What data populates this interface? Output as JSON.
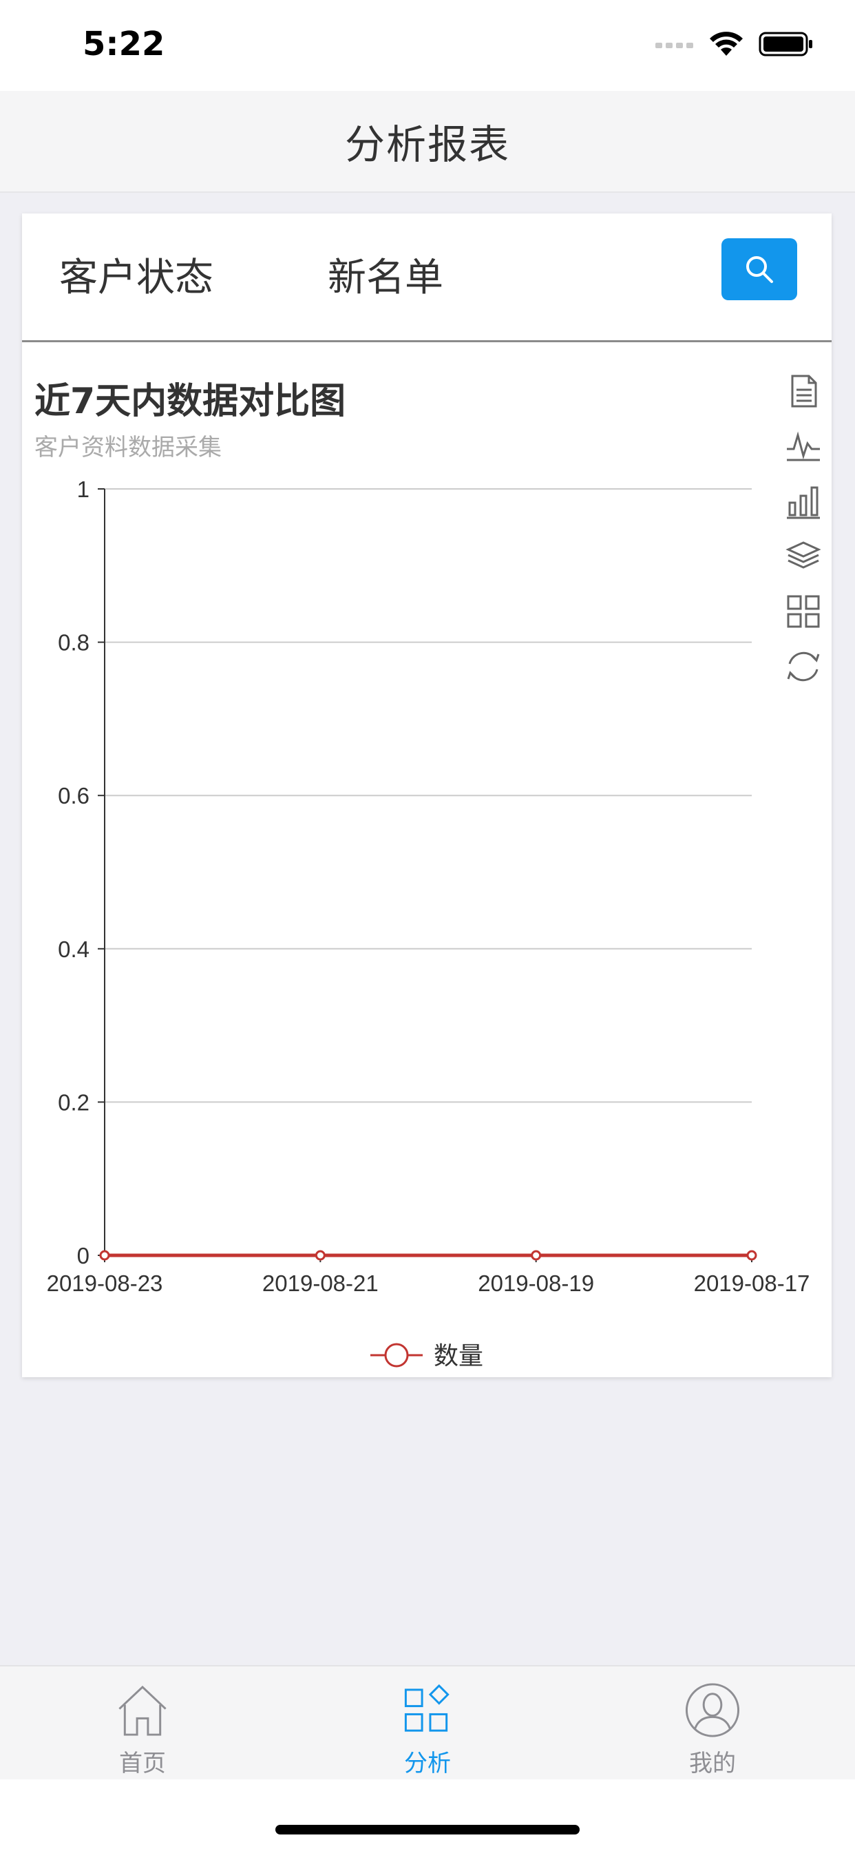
{
  "status": {
    "time": "5:22"
  },
  "nav": {
    "title": "分析报表"
  },
  "tabs": {
    "customer_status": "客户状态",
    "new_list": "新名单"
  },
  "chart": {
    "title": "近7天内数据对比图",
    "subtitle": "客户资料数据采集",
    "toolbox": [
      "document-icon",
      "line-chart-icon",
      "bar-chart-icon",
      "stack-icon",
      "tiled-icon",
      "refresh-icon"
    ]
  },
  "chart_data": {
    "type": "line",
    "x": [
      "2019-08-23",
      "2019-08-21",
      "2019-08-19",
      "2019-08-17"
    ],
    "series": [
      {
        "name": "数量",
        "values": [
          0,
          0,
          0,
          0
        ],
        "color": "#c23531"
      }
    ],
    "y_ticks": [
      "0",
      "0.2",
      "0.4",
      "0.6",
      "0.8",
      "1"
    ],
    "ylim": [
      0,
      1
    ],
    "grid": true,
    "legend": "bottom-center"
  },
  "tabbar": {
    "items": [
      {
        "label": "首页",
        "icon": "home-icon",
        "active": false
      },
      {
        "label": "分析",
        "icon": "analysis-icon",
        "active": true
      },
      {
        "label": "我的",
        "icon": "profile-icon",
        "active": false
      }
    ],
    "active_color": "#1296ec",
    "inactive_color": "#8e8e93"
  }
}
